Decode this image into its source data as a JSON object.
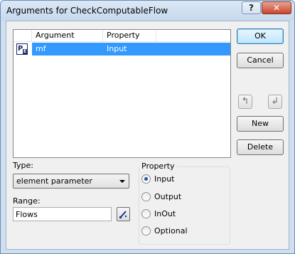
{
  "window": {
    "title": "Arguments for CheckComputableFlow",
    "help_label": "?",
    "close_label": "✕"
  },
  "grid": {
    "columns": [
      "Argument",
      "Property"
    ],
    "rows": [
      {
        "icon": "parameter-element-icon",
        "argument": "mf",
        "property": "Input",
        "selected": true
      }
    ]
  },
  "buttons": {
    "ok": "OK",
    "cancel": "Cancel",
    "move_up": "↰",
    "move_down": "↲",
    "new": "New",
    "delete": "Delete"
  },
  "type": {
    "label": "Type:",
    "value": "element parameter"
  },
  "range": {
    "label": "Range:",
    "value": "Flows"
  },
  "property_group": {
    "title": "Property",
    "options": [
      {
        "label": "Input",
        "checked": true
      },
      {
        "label": "Output",
        "checked": false
      },
      {
        "label": "InOut",
        "checked": false
      },
      {
        "label": "Optional",
        "checked": false
      }
    ]
  },
  "colors": {
    "selection": "#3399ff",
    "titlebar": "#c6d9ee",
    "close": "#c9452c"
  }
}
